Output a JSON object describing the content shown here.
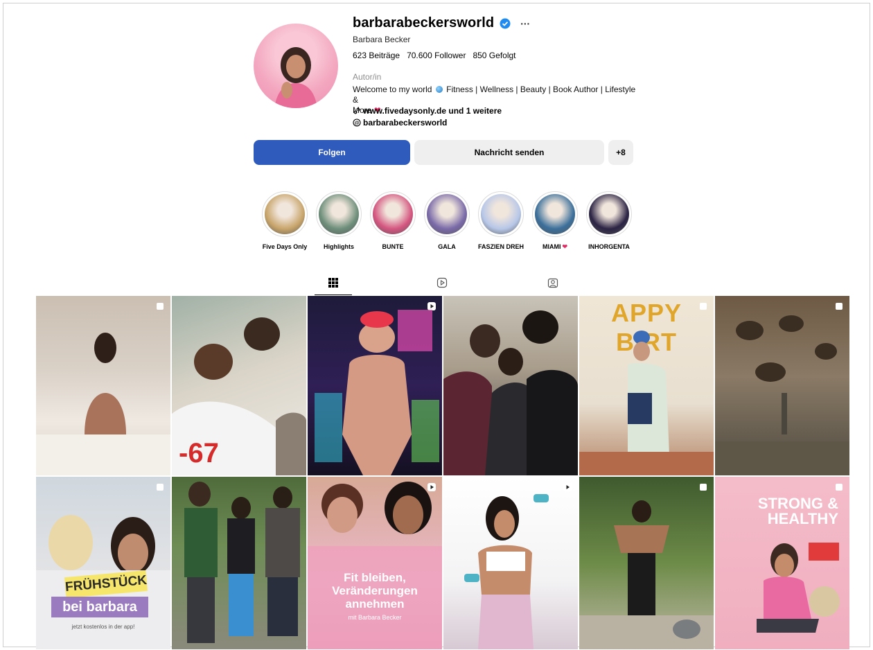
{
  "profile": {
    "username": "barbarabeckersworld",
    "full_name": "Barbara Becker",
    "more_label": "···",
    "posts": "623 Beiträge",
    "followers": "70.600 Follower",
    "following": "850 Gefolgt",
    "category": "Autor/in",
    "bio_line1_a": "Welcome to my world",
    "bio_line1_b": "Fitness | Wellness | Beauty | Book Author | Lifestyle &",
    "bio_line2": "More",
    "link": "www.fivedaysonly.de und 1 weitere",
    "threads": "barbarabeckersworld"
  },
  "actions": {
    "follow": "Folgen",
    "message": "Nachricht senden",
    "add_user": "+8"
  },
  "highlights": [
    {
      "label": "Five Days Only",
      "color": "#c8a56b"
    },
    {
      "label": "Highlights",
      "color": "#6e8f7b"
    },
    {
      "label": "BUNTE",
      "color": "#d45680"
    },
    {
      "label": "GALA",
      "color": "#7a6aa8"
    },
    {
      "label": "FASZIEN DREH",
      "color": "#b7c7e8"
    },
    {
      "label": "MIAMI",
      "color": "#3b6f9a"
    },
    {
      "label": "INHORGENTA",
      "color": "#2c2444"
    }
  ],
  "highlight_miami_heart": "❤",
  "posts_grid": [
    {
      "overlay": ""
    },
    {
      "overlay": "-67"
    },
    {
      "overlay": ""
    },
    {
      "overlay": ""
    },
    {
      "overlay": "APPY BIRT"
    },
    {
      "overlay": ""
    },
    {
      "overlay": "FRÜHSTÜCK",
      "sub1": "bei barbara",
      "sub2": "jetzt kostenlos in der app!"
    },
    {
      "overlay": ""
    },
    {
      "overlay": "Fit bleiben, Veränderungen annehmen",
      "sub1": "mit Barbara Becker"
    },
    {
      "overlay": ""
    },
    {
      "overlay": ""
    },
    {
      "overlay": "STRONG & HEALTHY"
    }
  ]
}
